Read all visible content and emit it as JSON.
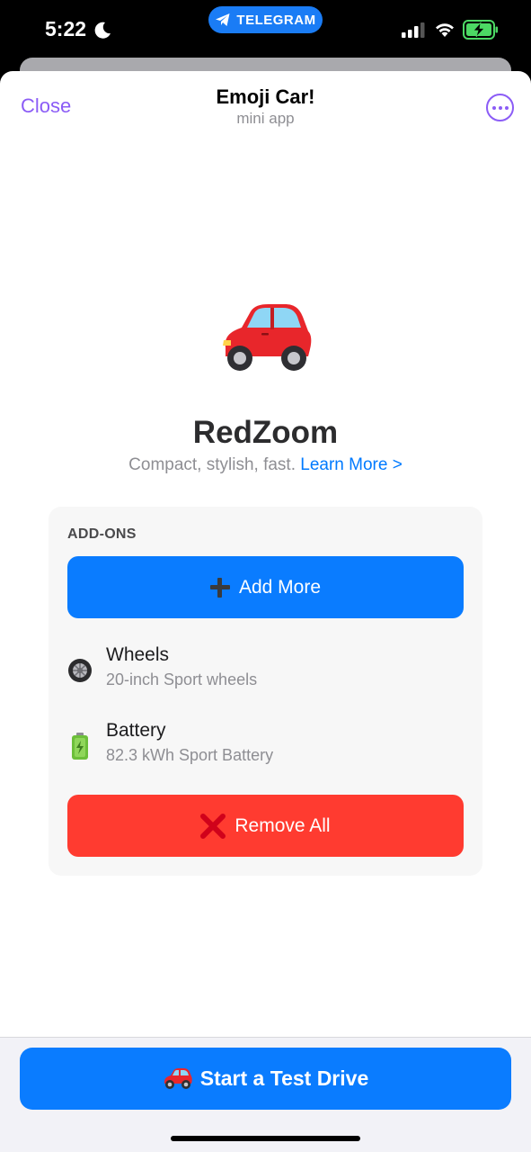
{
  "status_bar": {
    "time": "5:22",
    "pill_label": "TELEGRAM",
    "icons": [
      "moon-icon",
      "telegram-icon",
      "signal-icon",
      "wifi-icon",
      "battery-charging-icon"
    ]
  },
  "header": {
    "close_label": "Close",
    "title": "Emoji Car!",
    "subtitle": "mini app",
    "more_icon": "ellipsis-circle-icon"
  },
  "car": {
    "icon": "red-car-icon",
    "name": "RedZoom",
    "description": "Compact, stylish, fast.",
    "learn_more": "Learn More >"
  },
  "addons": {
    "heading": "ADD-ONS",
    "add_button": "Add More",
    "items": [
      {
        "name": "Wheels",
        "detail": "20-inch Sport wheels",
        "icon": "wheel-icon"
      },
      {
        "name": "Battery",
        "detail": "82.3 kWh Sport Battery",
        "icon": "battery-icon"
      }
    ],
    "remove_button": "Remove All"
  },
  "footer": {
    "test_drive_label": "Start a Test Drive"
  },
  "colors": {
    "accent_purple": "#8b5cf6",
    "primary_blue": "#0a7cff",
    "danger_red": "#ff3b30",
    "link_blue": "#007aff"
  }
}
